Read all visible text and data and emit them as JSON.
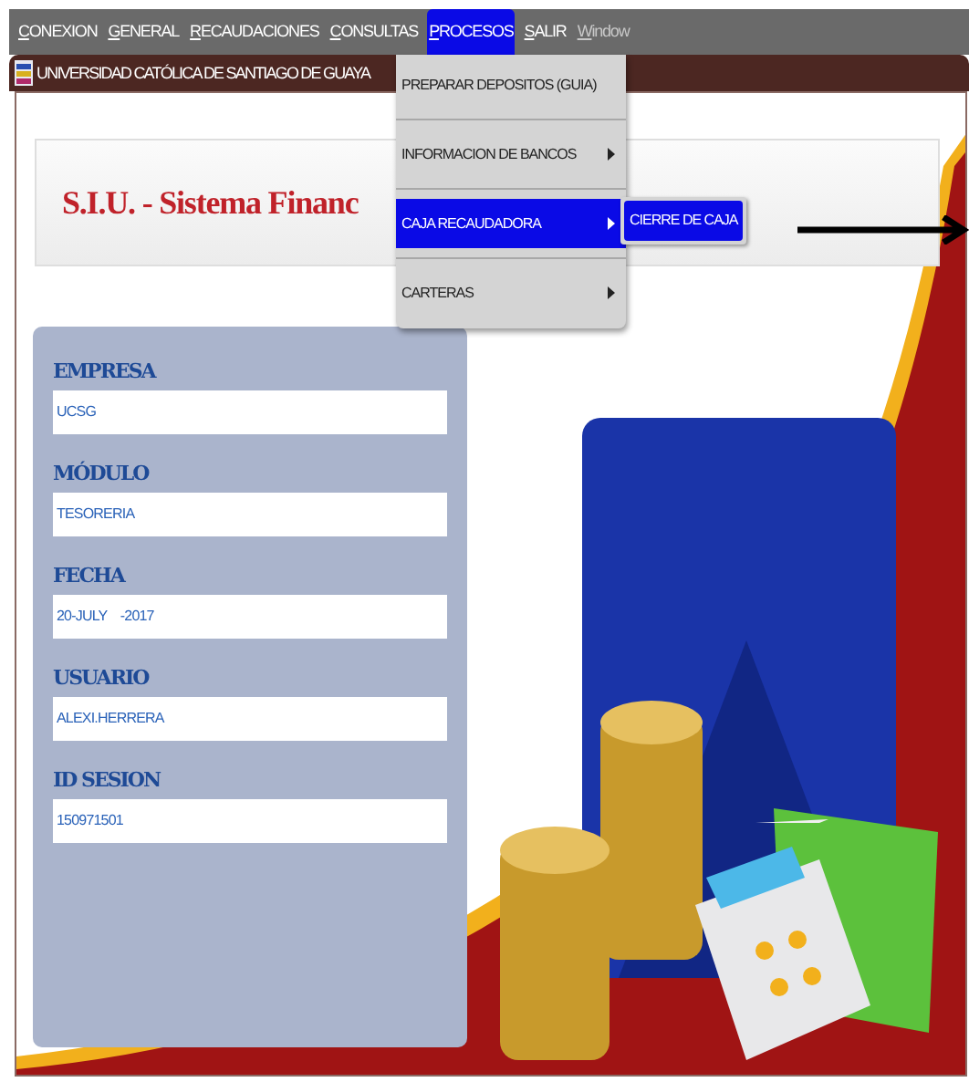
{
  "menubar": [
    {
      "label": "CONEXION",
      "selected": false,
      "disabled": false
    },
    {
      "label": "GENERAL",
      "selected": false,
      "disabled": false
    },
    {
      "label": "RECAUDACIONES",
      "selected": false,
      "disabled": false
    },
    {
      "label": "CONSULTAS",
      "selected": false,
      "disabled": false
    },
    {
      "label": "PROCESOS",
      "selected": true,
      "disabled": false
    },
    {
      "label": "SALIR",
      "selected": false,
      "disabled": false
    },
    {
      "label": "Window",
      "selected": false,
      "disabled": true
    }
  ],
  "window": {
    "title": "UNIVERSIDAD CATÓLICA DE SANTIAGO DE GUAYA"
  },
  "header": {
    "title": "S.I.U. - Sistema Financ"
  },
  "fields": [
    {
      "label": "EMPRESA",
      "value": "UCSG"
    },
    {
      "label": "MÓDULO",
      "value": "TESORERIA"
    },
    {
      "label": "FECHA",
      "value": "20-JULY    -2017"
    },
    {
      "label": "USUARIO",
      "value": "ALEXI.HERRERA"
    },
    {
      "label": "ID SESION",
      "value": "150971501"
    }
  ],
  "menu": {
    "items": [
      {
        "label": "PREPARAR DEPOSITOS (GUIA)",
        "submenu": false,
        "selected": false
      },
      {
        "label": "INFORMACION DE BANCOS",
        "submenu": true,
        "selected": false
      },
      {
        "label": "CAJA RECAUDADORA",
        "submenu": true,
        "selected": true
      },
      {
        "label": "CARTERAS",
        "submenu": true,
        "selected": false
      }
    ]
  },
  "submenu": {
    "items": [
      {
        "label": "CIERRE DE CAJA",
        "selected": true
      }
    ]
  }
}
